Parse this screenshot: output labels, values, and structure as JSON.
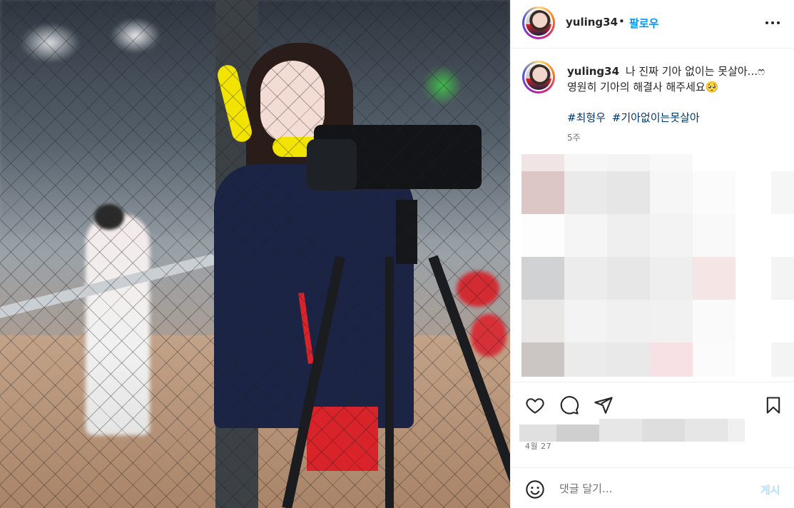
{
  "post": {
    "username": "yuling34",
    "dot": "•",
    "follow_label": "팔로우",
    "more_label": "•••",
    "caption_line1": "나 진짜 기아 없이는 못살아...ෆ",
    "caption_line2": "영원히 기아의 해결사 해주세요🥺",
    "hashtags": [
      "#최형우",
      "#기아없이는못살아"
    ],
    "age": "5주",
    "date": "4월 27"
  },
  "comment": {
    "placeholder": "댓글 달기...",
    "post_label": "게시"
  },
  "icons": {
    "like": "heart-icon",
    "comment": "comment-icon",
    "share": "paper-plane-icon",
    "save": "bookmark-icon",
    "emoji": "smiley-icon",
    "more": "more-options-icon"
  },
  "colors": {
    "link": "#0095f6",
    "hashtag": "#00376b",
    "muted": "#737373",
    "post_disabled": "#b2dffc"
  }
}
